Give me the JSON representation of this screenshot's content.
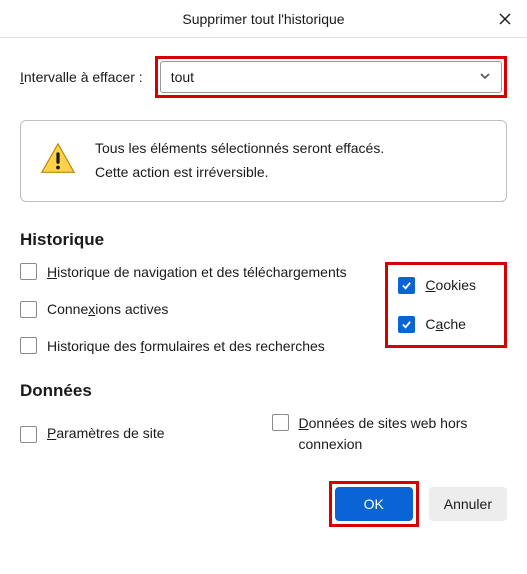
{
  "title": "Supprimer tout l'historique",
  "range": {
    "label_pre": "I",
    "label_rest": "ntervalle à effacer :",
    "selected": "tout"
  },
  "warning": {
    "line1": "Tous les éléments sélectionnés seront effacés.",
    "line2": "Cette action est irréversible."
  },
  "sections": {
    "history": "Historique",
    "data": "Données"
  },
  "history_items": {
    "browsing": {
      "pre": "H",
      "rest": "istorique de navigation et des téléchargements",
      "checked": false
    },
    "cookies": {
      "pre": "C",
      "rest": "ookies",
      "checked": true
    },
    "logins": {
      "pre": "Conne",
      "mid": "x",
      "rest": "ions actives",
      "checked": false
    },
    "cache": {
      "pre": "C",
      "mid": "a",
      "rest": "che",
      "checked": true
    },
    "forms": {
      "pre": "Historique des ",
      "mid": "f",
      "rest": "ormulaires et des recherches",
      "checked": false
    }
  },
  "data_items": {
    "site_settings": {
      "pre": "P",
      "rest": "aramètres de site",
      "checked": false
    },
    "offline": {
      "pre": "D",
      "rest": "onnées de sites web hors connexion",
      "checked": false
    }
  },
  "buttons": {
    "ok": "OK",
    "cancel": "Annuler"
  }
}
